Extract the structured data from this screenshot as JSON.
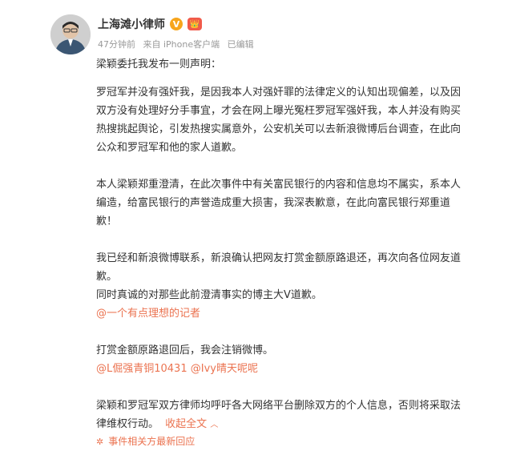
{
  "post": {
    "author": "上海滩小律师",
    "badges": {
      "verified": "V",
      "member": "👑"
    },
    "meta": {
      "time": "47分钟前",
      "source": "来自 iPhone客户端",
      "edited": "已编辑"
    },
    "intro": "梁颖委托我发布一则声明：",
    "paragraphs": [
      {
        "lines": [
          "罗冠军并没有强奸我，是因我本人对强奸罪的法律定义的认知出现偏差，以及因",
          "双方没有处理好分手事宜，才会在网上曝光冤枉罗冠军强奸我，本人并没有购买",
          "热搜挑起舆论，引发热搜实属意外，公安机关可以去新浪微博后台调查，在此向",
          "公众和罗冠军和他的家人道歉。"
        ]
      },
      {
        "lines": [
          "本人梁颖郑重澄清，在此次事件中有关富民银行的内容和信息均不属实，系本人",
          "编造，给富民银行的声誉造成重大损害，我深表歉意，在此向富民银行郑重道",
          "歉！"
        ]
      }
    ],
    "p3_lines": [
      "我已经和新浪微博联系，新浪确认把网友打赏金额原路退还，再次向各位网友道",
      "歉。",
      "同时真诚的对那些此前澄清事实的博主大V道歉。"
    ],
    "mention1": "@一个有点理想的记者",
    "p4": "打赏金额原路退回后，我会注销微博。",
    "mention2": "@L倔强青铜10431",
    "mention3": "@Ivy晴天呢呢",
    "p5_lines": [
      "梁颖和罗冠军双方律师均呼吁各大网络平台删除双方的个人信息，否则将采取法",
      "律维权行动。"
    ],
    "fold": "收起全文",
    "fold_icon": "chevron-up",
    "topic": "事件相关方最新回应",
    "colors": {
      "accent": "#eb7350",
      "text": "#333333",
      "meta": "#999999"
    }
  }
}
